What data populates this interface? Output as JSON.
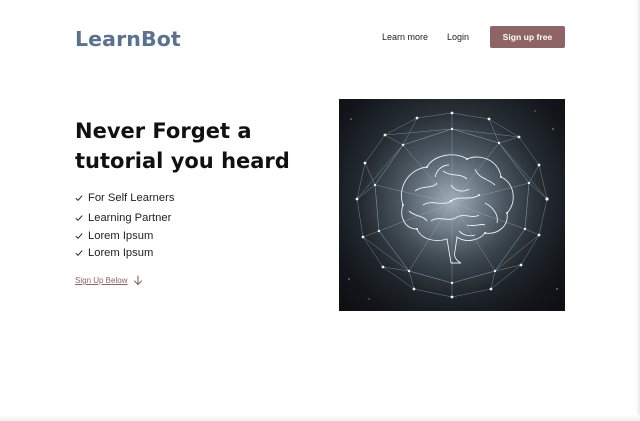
{
  "header": {
    "logo": "LearnBot",
    "nav": {
      "learn_more": "Learn more",
      "login": "Login",
      "signup": "Sign up free"
    }
  },
  "hero": {
    "headline": "Never Forget a tutorial you heard",
    "features": [
      "For Self Learners",
      "Learning Partner",
      "Lorem Ipsum",
      "Lorem Ipsum"
    ],
    "cta_link": "Sign Up Below",
    "image": "glowing wireframe brain inside a polygon network sphere"
  },
  "colors": {
    "logo": "#5a7190",
    "accent": "#8f6464",
    "text": "#111111"
  },
  "icons": {
    "feature_bullet": "check-icon",
    "cta": "arrow-down-icon"
  }
}
